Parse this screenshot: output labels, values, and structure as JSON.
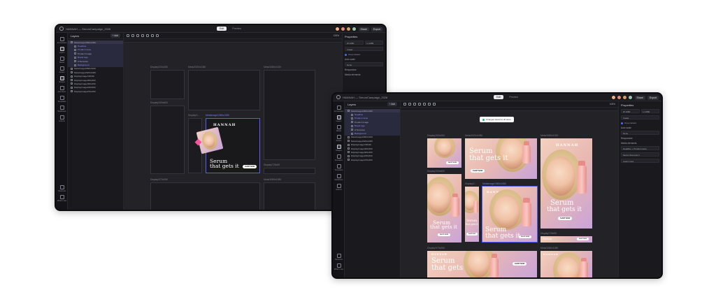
{
  "title": "HANNAH — SerumCampaign_2026",
  "tabs": [
    "Edit",
    "Preview"
  ],
  "share_label": "Share",
  "export_label": "Export",
  "rail": [
    "AI Assistant",
    "Layers",
    "Media",
    "Assets",
    "Shapes",
    "Animation",
    "Templates",
    "Workflows",
    "Actions",
    "Shortcuts",
    "What's new"
  ],
  "layers": {
    "title": "Layers",
    "add": "+ Add",
    "rows": [
      {
        "label": "MetaImage1080x1080",
        "kind": "sel"
      },
      {
        "label": "Headline",
        "kind": "childsel"
      },
      {
        "label": "Product name",
        "kind": "childsel"
      },
      {
        "label": "Product Image",
        "kind": "child"
      },
      {
        "label": "Brand logo",
        "kind": "childsel"
      },
      {
        "label": "CTA button",
        "kind": "child"
      },
      {
        "label": "Background",
        "kind": "childsel"
      },
      {
        "label": "MetaImage1080x1920",
        "kind": "row"
      },
      {
        "label": "MetaImage1920x1080",
        "kind": "row"
      },
      {
        "label": "DisplayImage728x90",
        "kind": "row"
      },
      {
        "label": "DisplayImage300x600",
        "kind": "row"
      },
      {
        "label": "DisplayImage300x250",
        "kind": "row"
      },
      {
        "label": "DisplayImage160x600",
        "kind": "row"
      },
      {
        "label": "DisplayImage970x250",
        "kind": "row"
      }
    ]
  },
  "zoom": "100%",
  "props": {
    "title": "Properties",
    "w": "W 1080",
    "h": "H 1080",
    "fit": "Image",
    "chk": "Crop content",
    "rule": "Auto scale",
    "rule_val": "None",
    "responsive": "Responsive",
    "media": "Media elements",
    "media_items": [
      "Headline + Product name",
      "Serum that gets it",
      "Learn more"
    ]
  },
  "frames_a": [
    "Display/300x250",
    "Meta/1920x1080",
    "Meta/1080x1920",
    "Display/300x600",
    "Display/1…",
    "MetaImage1080x1080",
    "Display/728x90",
    "Display/970x250",
    "Meta/1080x1080"
  ],
  "frames_b": [
    "Display/300x250",
    "Meta/1920x1080",
    "Meta/1080x1920",
    "Display/300x600",
    "Display/1…",
    "MetaImage1080x1080",
    "Display/728x90",
    "Display/970x250",
    "Meta/1080x1080"
  ],
  "toast": "Changes saved to all sizes",
  "ad": {
    "brand": "HANNAH",
    "headline_1": "Serum",
    "headline_2": "that gets it",
    "cta": "SHOP NOW"
  }
}
